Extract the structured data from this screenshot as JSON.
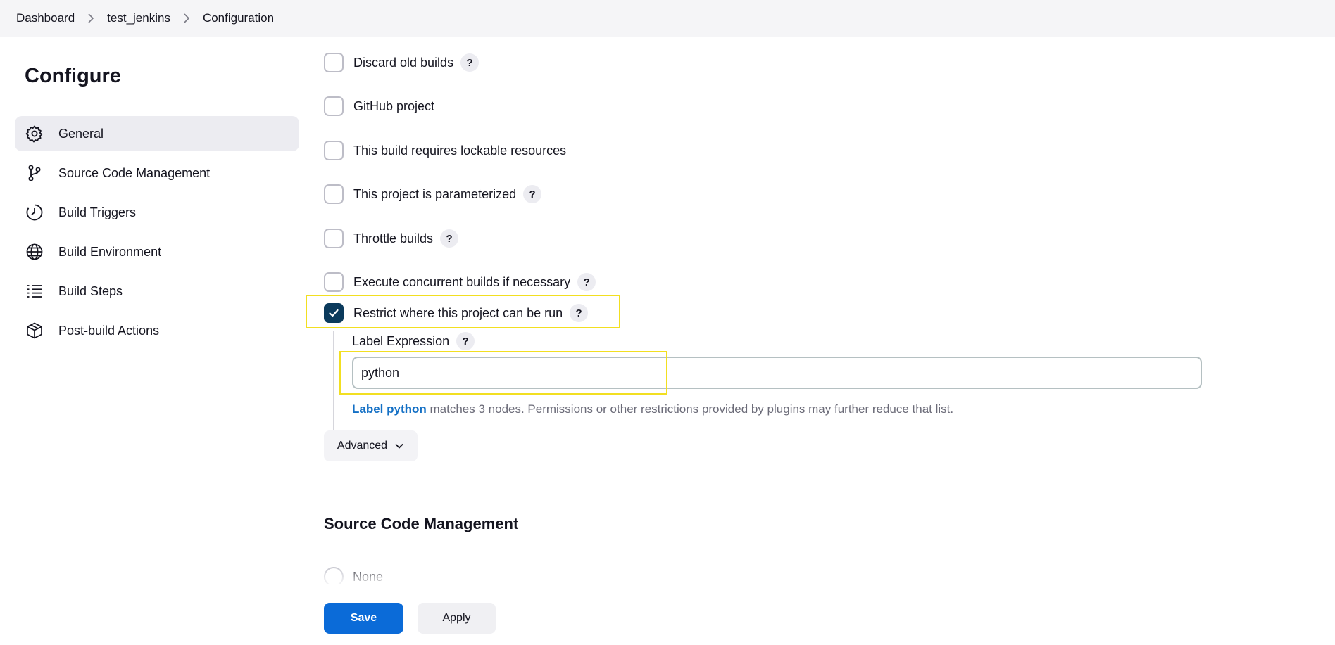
{
  "breadcrumb": {
    "items": [
      "Dashboard",
      "test_jenkins",
      "Configuration"
    ]
  },
  "sidebar": {
    "title": "Configure",
    "items": [
      {
        "label": "General",
        "icon": "gear-icon",
        "active": true
      },
      {
        "label": "Source Code Management",
        "icon": "branch-icon",
        "active": false
      },
      {
        "label": "Build Triggers",
        "icon": "clock-icon",
        "active": false
      },
      {
        "label": "Build Environment",
        "icon": "globe-icon",
        "active": false
      },
      {
        "label": "Build Steps",
        "icon": "list-icon",
        "active": false
      },
      {
        "label": "Post-build Actions",
        "icon": "cube-icon",
        "active": false
      }
    ]
  },
  "general": {
    "options": [
      {
        "label": "Discard old builds",
        "checked": false,
        "help": "?"
      },
      {
        "label": "GitHub project",
        "checked": false
      },
      {
        "label": "This build requires lockable resources",
        "checked": false
      },
      {
        "label": "This project is parameterized",
        "checked": false,
        "help": "?"
      },
      {
        "label": "Throttle builds",
        "checked": false,
        "help": "?"
      },
      {
        "label": "Execute concurrent builds if necessary",
        "checked": false,
        "help": "?"
      },
      {
        "label": "Restrict where this project can be run",
        "checked": true,
        "help": "?"
      }
    ],
    "label_expression": {
      "label": "Label Expression",
      "help": "?",
      "value": "python",
      "hint_link": "Label python",
      "hint_text": " matches 3 nodes. Permissions or other restrictions provided by plugins may further reduce that list."
    },
    "advanced_label": "Advanced"
  },
  "scm": {
    "title": "Source Code Management",
    "options": [
      {
        "label": "None",
        "selected": false
      }
    ]
  },
  "footer": {
    "save_label": "Save",
    "apply_label": "Apply"
  },
  "colors": {
    "primary": "#0b6bd8",
    "checkbox_checked": "#0b3a5c",
    "highlight": "#f2df21",
    "link": "#1470c5"
  }
}
